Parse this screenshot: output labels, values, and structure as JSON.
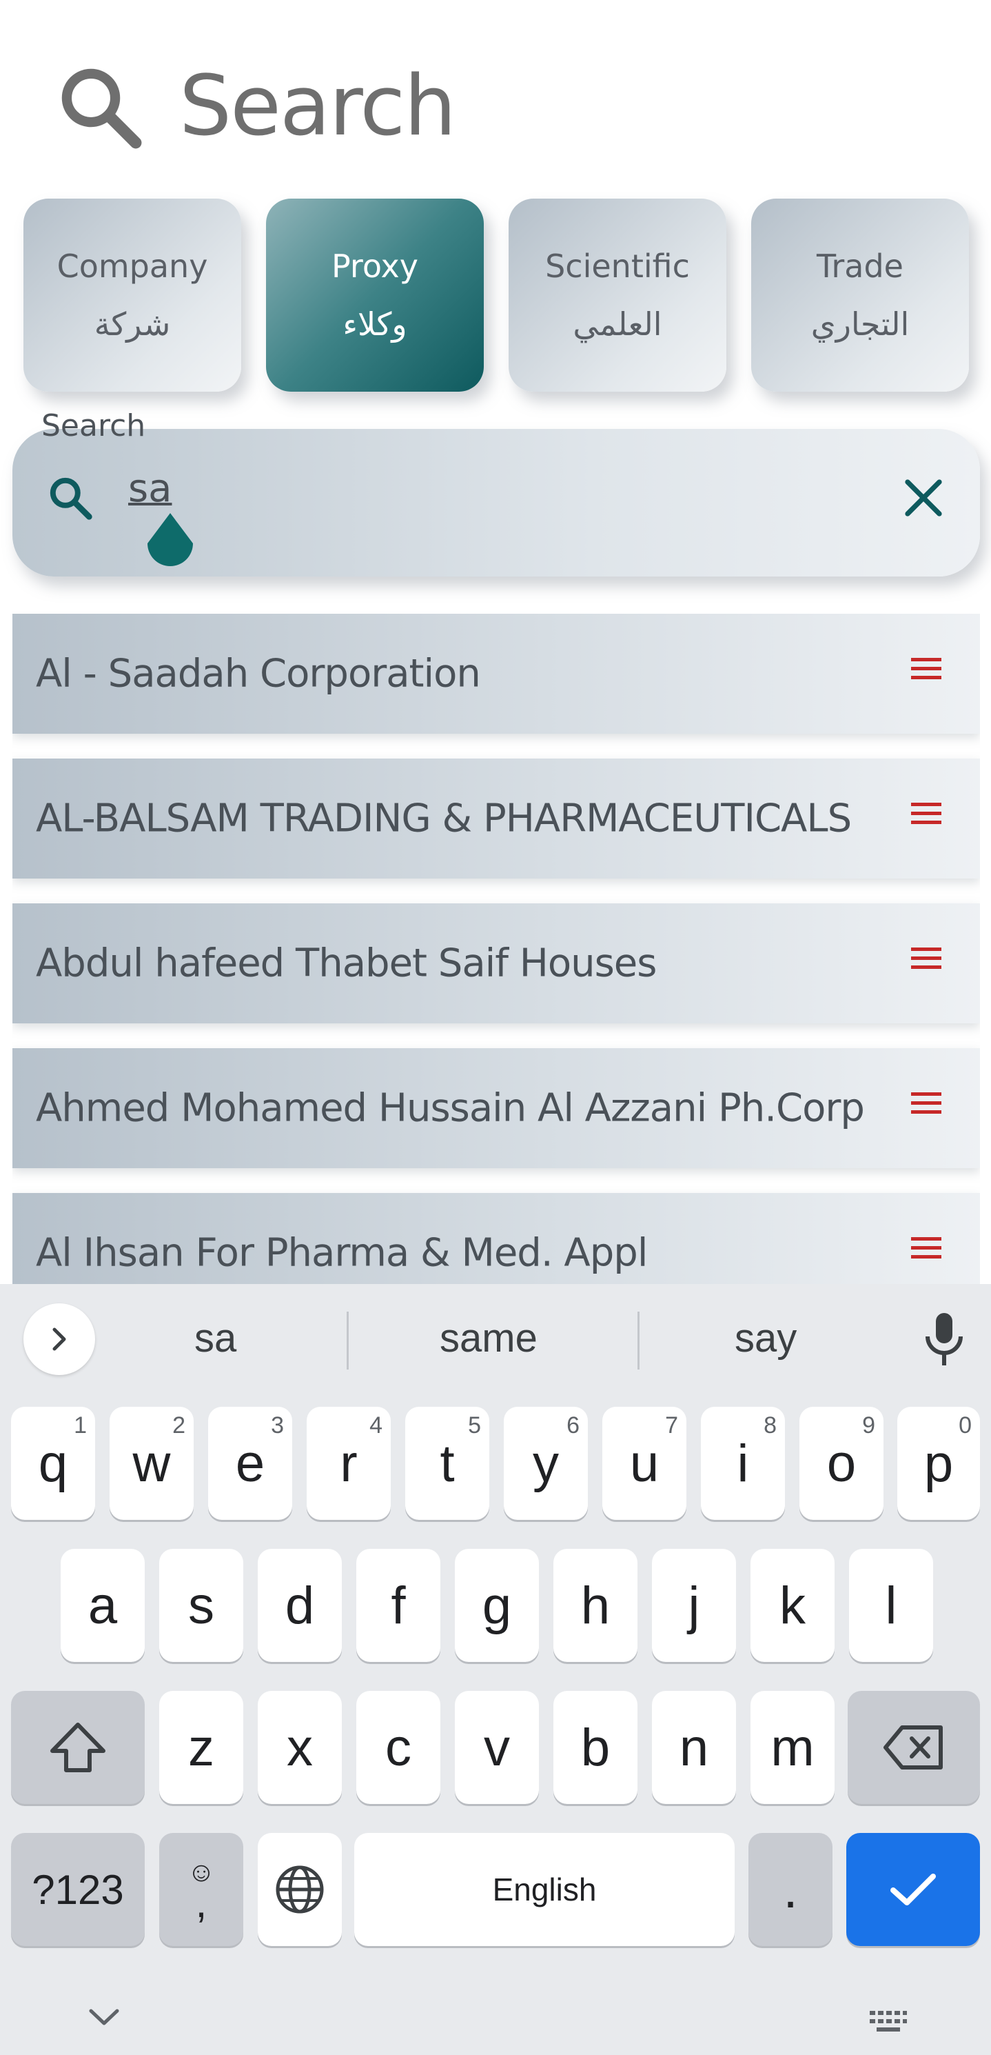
{
  "header": {
    "title": "Search",
    "icon": "search-icon"
  },
  "tabs": [
    {
      "en": "Company",
      "ar": "شركة",
      "active": false
    },
    {
      "en": "Proxy",
      "ar": "وكلاء",
      "active": true
    },
    {
      "en": "Scientific",
      "ar": "العلمي",
      "active": false
    },
    {
      "en": "Trade",
      "ar": "التجاري",
      "active": false
    }
  ],
  "search": {
    "label": "Search",
    "value": "sa",
    "clear_icon": "close-icon"
  },
  "results": [
    {
      "name": "Al - Saadah Corporation"
    },
    {
      "name": "AL-BALSAM TRADING & PHARMACEUTICALS"
    },
    {
      "name": "Abdul hafeed Thabet Saif Houses"
    },
    {
      "name": "Ahmed Mohamed Hussain Al Azzani Ph.Corp"
    },
    {
      "name": "Al Ihsan For Pharma & Med. Appl"
    }
  ],
  "colors": {
    "accent": "#0e5a5e",
    "menu_icon": "#c62828",
    "enter_key": "#1a73e8"
  },
  "keyboard": {
    "suggestions": [
      "sa",
      "same",
      "say"
    ],
    "row1": [
      {
        "k": "q",
        "h": "1"
      },
      {
        "k": "w",
        "h": "2"
      },
      {
        "k": "e",
        "h": "3"
      },
      {
        "k": "r",
        "h": "4"
      },
      {
        "k": "t",
        "h": "5"
      },
      {
        "k": "y",
        "h": "6"
      },
      {
        "k": "u",
        "h": "7"
      },
      {
        "k": "i",
        "h": "8"
      },
      {
        "k": "o",
        "h": "9"
      },
      {
        "k": "p",
        "h": "0"
      }
    ],
    "row2": [
      "a",
      "s",
      "d",
      "f",
      "g",
      "h",
      "j",
      "k",
      "l"
    ],
    "row3": [
      "z",
      "x",
      "c",
      "v",
      "b",
      "n",
      "m"
    ],
    "symbols_label": "?123",
    "comma_label": ",",
    "space_label": "English",
    "period_label": "."
  }
}
